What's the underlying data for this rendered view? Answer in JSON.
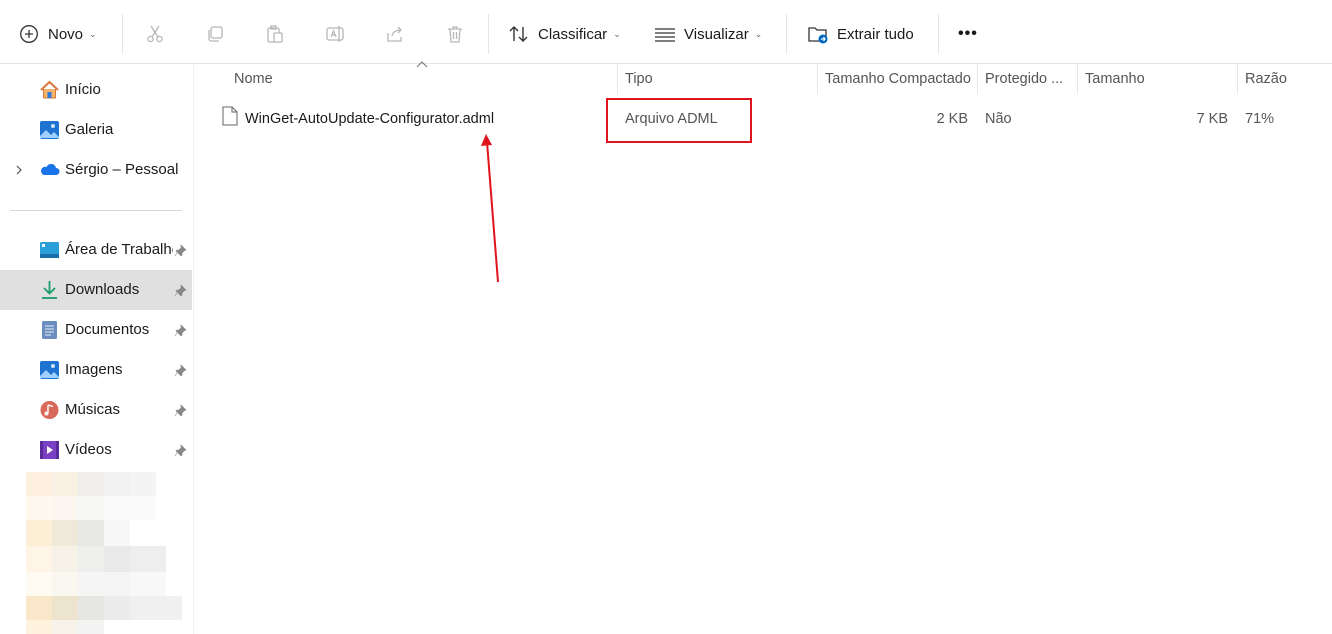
{
  "toolbar": {
    "new_label": "Novo",
    "sort_label": "Classificar",
    "view_label": "Visualizar",
    "extract_label": "Extrair tudo",
    "more_label": "•••"
  },
  "sidebar": {
    "top_items": [
      {
        "label": "Início"
      },
      {
        "label": "Galeria"
      },
      {
        "label": "Sérgio – Pessoal"
      }
    ],
    "pinned_items": [
      {
        "label": "Área de Trabalho"
      },
      {
        "label": "Downloads"
      },
      {
        "label": "Documentos"
      },
      {
        "label": "Imagens"
      },
      {
        "label": "Músicas"
      },
      {
        "label": "Vídeos"
      }
    ]
  },
  "columns": {
    "name": "Nome",
    "type": "Tipo",
    "compressed": "Tamanho Compactado",
    "protected": "Protegido ...",
    "size": "Tamanho",
    "ratio": "Razão"
  },
  "files": [
    {
      "name": "WinGet-AutoUpdate-Configurator.adml",
      "type": "Arquivo ADML",
      "compressed": "2 KB",
      "protected": "Não",
      "size": "7 KB",
      "ratio": "71%"
    }
  ],
  "colors": {
    "highlight": "#e0141c",
    "selection": "#e0e0e0",
    "accent": "#0067c0"
  }
}
